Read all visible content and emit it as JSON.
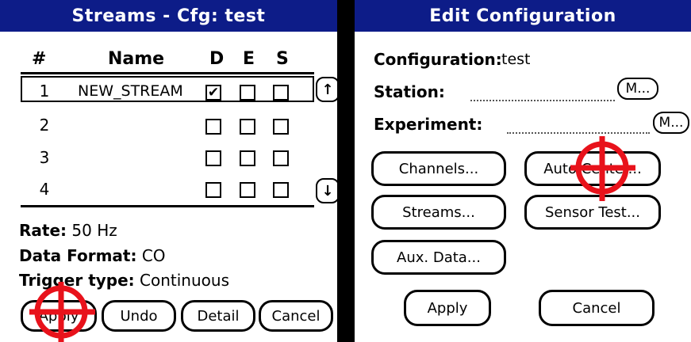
{
  "left": {
    "title": "Streams - Cfg: test",
    "headers": {
      "num": "#",
      "name": "Name",
      "d": "D",
      "e": "E",
      "s": "S"
    },
    "rows": [
      {
        "num": "1",
        "name": "NEW_STREAM",
        "d": true,
        "e": false,
        "s": false
      },
      {
        "num": "2",
        "name": "",
        "d": false,
        "e": false,
        "s": false
      },
      {
        "num": "3",
        "name": "",
        "d": false,
        "e": false,
        "s": false
      },
      {
        "num": "4",
        "name": "",
        "d": false,
        "e": false,
        "s": false
      }
    ],
    "scroll_up_icon": "up-arrow",
    "scroll_down_icon": "down-arrow",
    "rate_label": "Rate:",
    "rate_value": "50 Hz",
    "format_label": "Data Format:",
    "format_value": "CO",
    "trigger_label": "Trigger type:",
    "trigger_value": "Continuous",
    "buttons": {
      "apply": "Apply",
      "undo": "Undo",
      "detail": "Detail",
      "cancel": "Cancel"
    }
  },
  "right": {
    "title": "Edit Configuration",
    "config_label": "Configuration:",
    "config_value": "test",
    "station_label": "Station:",
    "station_value": "",
    "station_button": "M...",
    "experiment_label": "Experiment:",
    "experiment_value": "",
    "experiment_button": "M...",
    "buttons": {
      "channels": "Channels...",
      "auto_center": "Auto Center...",
      "streams": "Streams...",
      "sensor_test": "Sensor Test...",
      "aux_data": "Aux. Data...",
      "apply": "Apply",
      "cancel": "Cancel"
    }
  },
  "colors": {
    "titlebar": "#0d1c88",
    "crosshair": "#e8121b"
  },
  "cursor_icon": "red-crosshair-target"
}
